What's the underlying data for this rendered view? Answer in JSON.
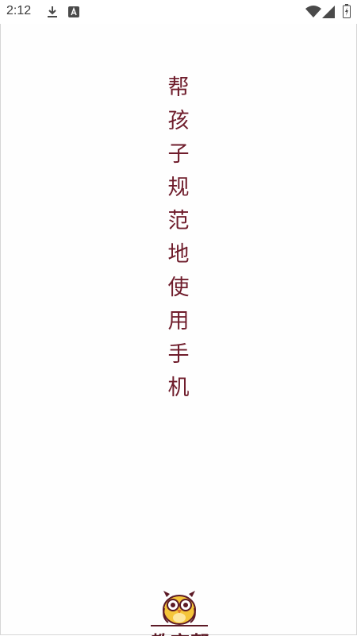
{
  "status_bar": {
    "time": "2:12",
    "icons": [
      "download-icon",
      "accessibility-a-icon",
      "wifi-icon",
      "signal-icon",
      "battery-charging-icon"
    ]
  },
  "slogan": {
    "chars": [
      "帮",
      "孩",
      "子",
      "规",
      "范",
      "地",
      "使",
      "用",
      "手",
      "机"
    ]
  },
  "logo": {
    "text": "教育帮",
    "icon": "owl-icon"
  },
  "colors": {
    "slogan": "#6f1d2c",
    "owl_body": "#f5c53a",
    "owl_outline": "#5c1a26"
  }
}
